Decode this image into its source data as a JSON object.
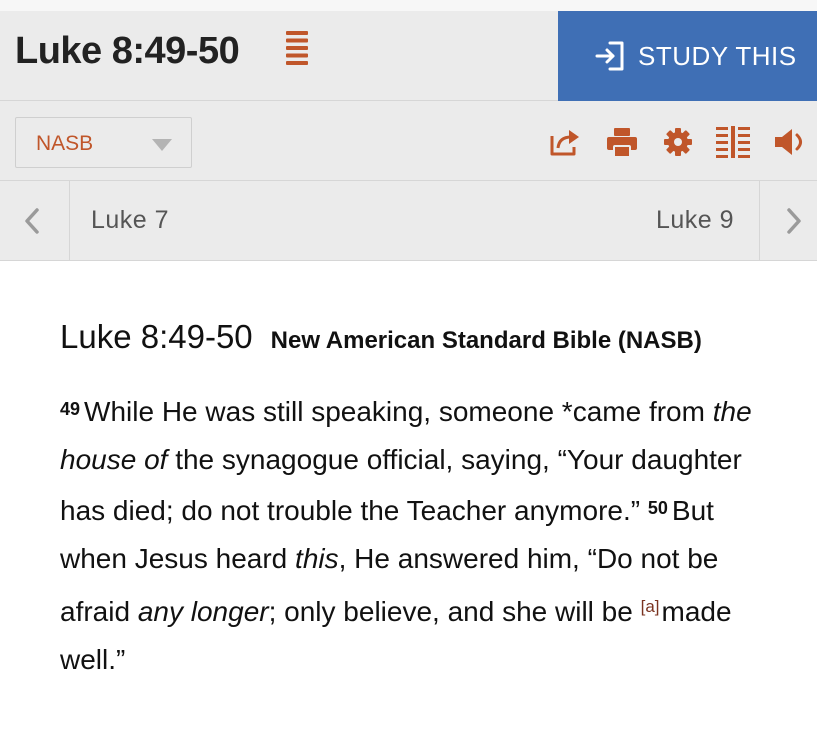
{
  "header": {
    "passage_title": "Luke 8:49-50",
    "menu_icon": "list-menu-icon",
    "study_button_label": "STUDY THIS",
    "study_button_icon": "sign-in-icon",
    "study_button_color": "#3f6fb5"
  },
  "toolbar": {
    "version_value": "NASB",
    "icons": [
      "share-icon",
      "print-icon",
      "gear-icon",
      "parallel-columns-icon",
      "speaker-icon"
    ],
    "accent_color": "#c0562a"
  },
  "chapter_nav": {
    "prev_label": "Luke 7",
    "next_label": "Luke 9"
  },
  "passage": {
    "reference": "Luke 8:49-50",
    "version_name": "New American Standard Bible (NASB)",
    "verses": [
      {
        "number": "49",
        "parts": [
          "While He was still speaking, someone *came from ",
          "the house of",
          " the synagogue official, saying, “Your daughter has died; do not trouble the Teacher anymore.” "
        ]
      },
      {
        "number": "50",
        "parts": [
          "But when Jesus heard ",
          "this",
          ", He answered him, “Do not be afraid ",
          "any longer",
          "; only believe, and she will be ",
          "[a]",
          "made well.”"
        ]
      }
    ]
  }
}
